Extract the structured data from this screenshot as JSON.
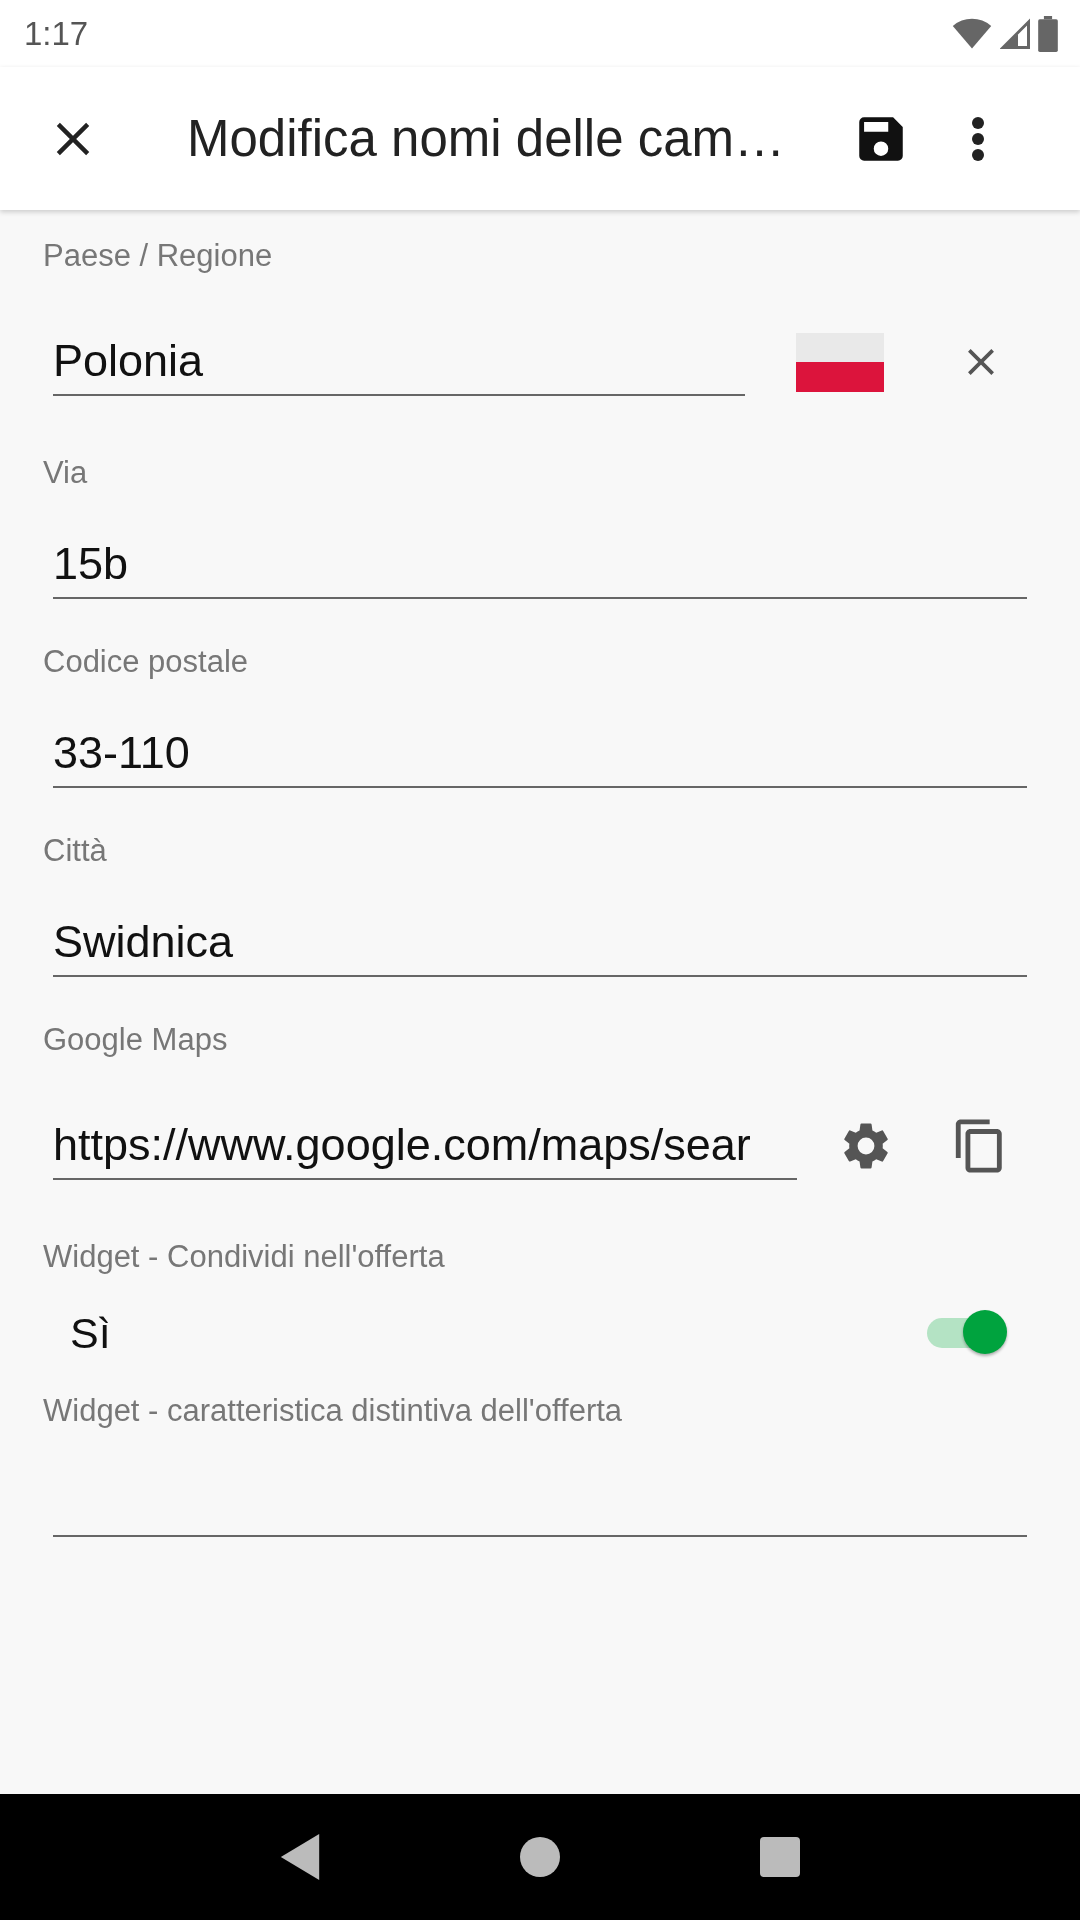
{
  "status_bar": {
    "time": "1:17"
  },
  "app_bar": {
    "title": "Modifica nomi delle cam…"
  },
  "fields": [
    {
      "kind": "country",
      "label": "Paese / Regione",
      "value": "Polonia"
    },
    {
      "kind": "text",
      "label": "Via",
      "value": "15b"
    },
    {
      "kind": "text",
      "label": "Codice postale",
      "value": "33-110"
    },
    {
      "kind": "text",
      "label": "Città",
      "value": "Swidnica"
    },
    {
      "kind": "url",
      "label": "Google Maps",
      "value": "https://www.google.com/maps/sear"
    },
    {
      "kind": "toggle",
      "label": "Widget - Condividi nell'offerta",
      "value": "Sì",
      "on": true
    },
    {
      "kind": "text",
      "label": "Widget - caratteristica distintiva dell'offerta"
    }
  ]
}
